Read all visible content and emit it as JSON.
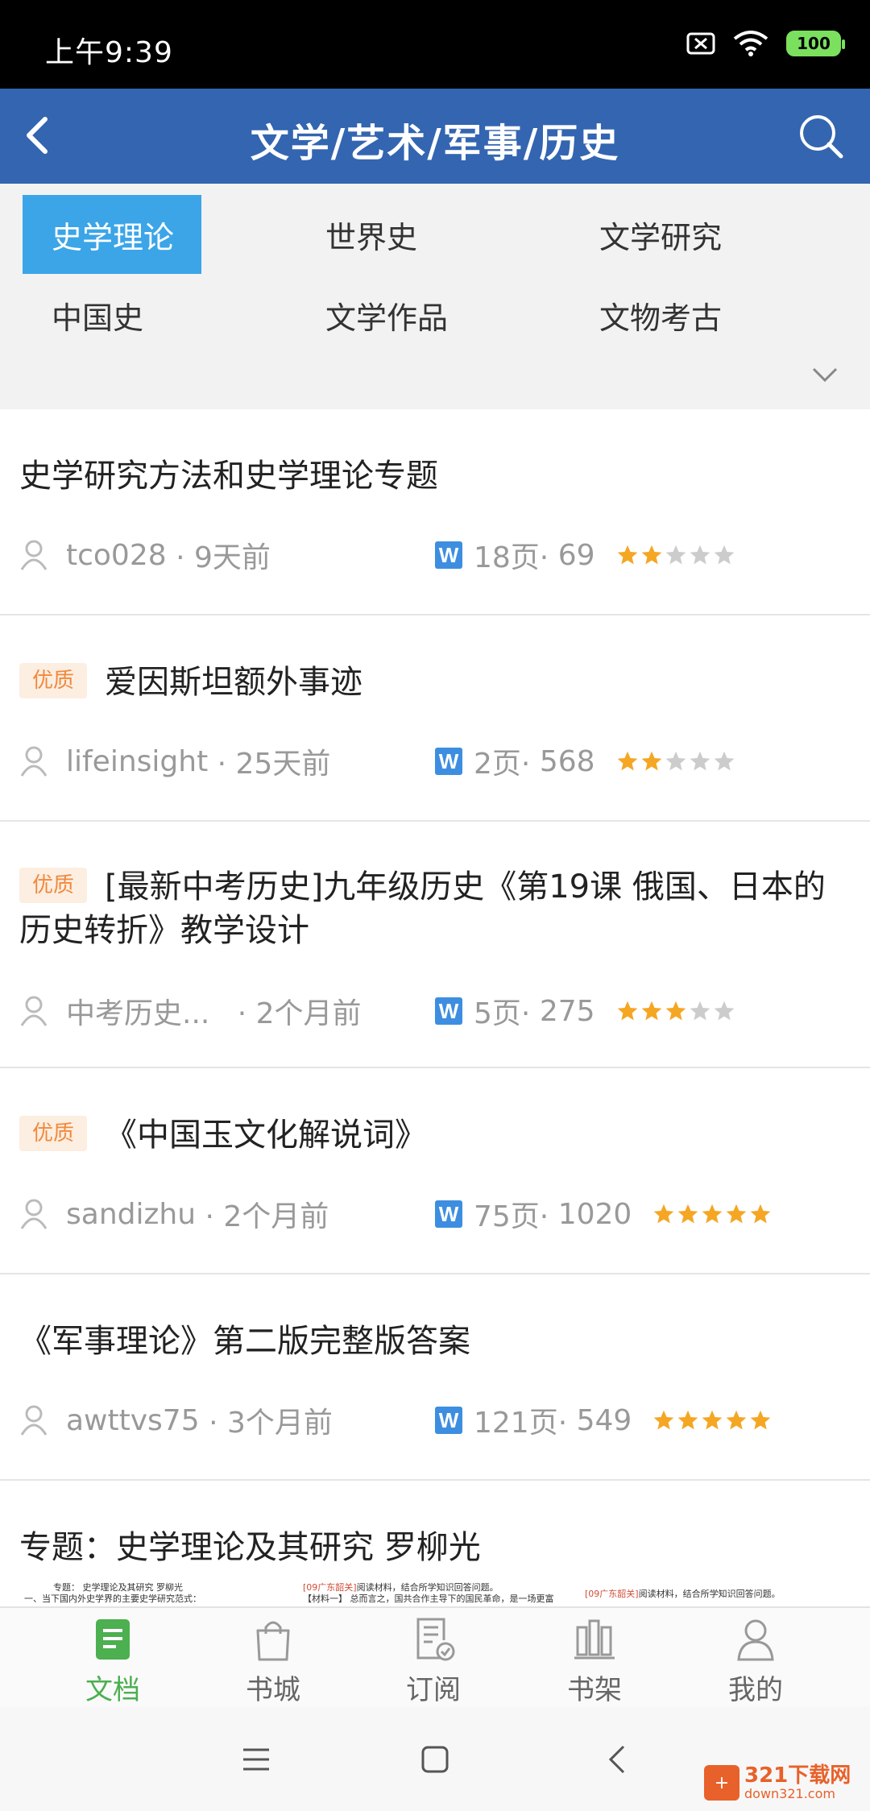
{
  "status_bar": {
    "time": "上午9:39",
    "battery": "100"
  },
  "app_bar": {
    "title": "文学/艺术/军事/历史"
  },
  "categories": [
    {
      "label": "史学理论",
      "active": true
    },
    {
      "label": "世界史",
      "active": false
    },
    {
      "label": "文学研究",
      "active": false
    },
    {
      "label": "中国史",
      "active": false
    },
    {
      "label": "文学作品",
      "active": false
    },
    {
      "label": "文物考古",
      "active": false
    }
  ],
  "documents": [
    {
      "title": "史学研究方法和史学理论专题",
      "tag": "",
      "author": "tco028",
      "time": "· 9天前",
      "pages": "18页·",
      "views": "69",
      "rating": 2
    },
    {
      "title": "爱因斯坦额外事迹",
      "tag": "优质",
      "author": "lifeinsight",
      "time": "· 25天前",
      "pages": "2页·",
      "views": "568",
      "rating": 2
    },
    {
      "title": "[最新中考历史]九年级历史《第19课 俄国、日本的历史转折》教学设计",
      "tag": "优质",
      "author": "中考历史...",
      "time": "· 2个月前",
      "pages": "5页·",
      "views": "275",
      "rating": 3
    },
    {
      "title": "《中国玉文化解说词》",
      "tag": "优质",
      "author": "sandizhu",
      "time": "· 2个月前",
      "pages": "75页·",
      "views": "1020",
      "rating": 5
    },
    {
      "title": "《军事理论》第二版完整版答案",
      "tag": "",
      "author": "awttvs75",
      "time": "· 3个月前",
      "pages": "121页·",
      "views": "549",
      "rating": 5
    },
    {
      "title": "专题：史学理论及其研究 罗柳光",
      "tag": "",
      "author": "",
      "time": "",
      "pages": "",
      "views": "",
      "rating": 0
    }
  ],
  "preview": {
    "p1_line1": "专题：  史学理论及其研究    罗柳光",
    "p1_line2": "一、当下国内外史学界的主要史学研究范式：",
    "p2_tag": "[09广东韶关]",
    "p2_line1": "阅读材料，结合所学知识回答问题。",
    "p2_line2": "【材料一】 总而言之，国共合作主导下的国民革命，是一场更富",
    "p3_tag": "[09广东韶关]",
    "p3_line1": "阅读材料，结合所学知识回答问题。"
  },
  "bottom_nav": [
    {
      "label": "文档",
      "icon": "document-icon",
      "active": true
    },
    {
      "label": "书城",
      "icon": "shopping-bag-icon",
      "active": false
    },
    {
      "label": "订阅",
      "icon": "subscribe-icon",
      "active": false
    },
    {
      "label": "书架",
      "icon": "bookshelf-icon",
      "active": false
    },
    {
      "label": "我的",
      "icon": "profile-icon",
      "active": false
    }
  ],
  "watermark": {
    "brand": "321下载网",
    "url": "down321.com"
  },
  "colors": {
    "app_bar": "#3365b1",
    "active_category": "#3ba5e8",
    "active_tab": "#4caf50",
    "star": "#f5a623",
    "tag_text": "#f08a3c"
  }
}
